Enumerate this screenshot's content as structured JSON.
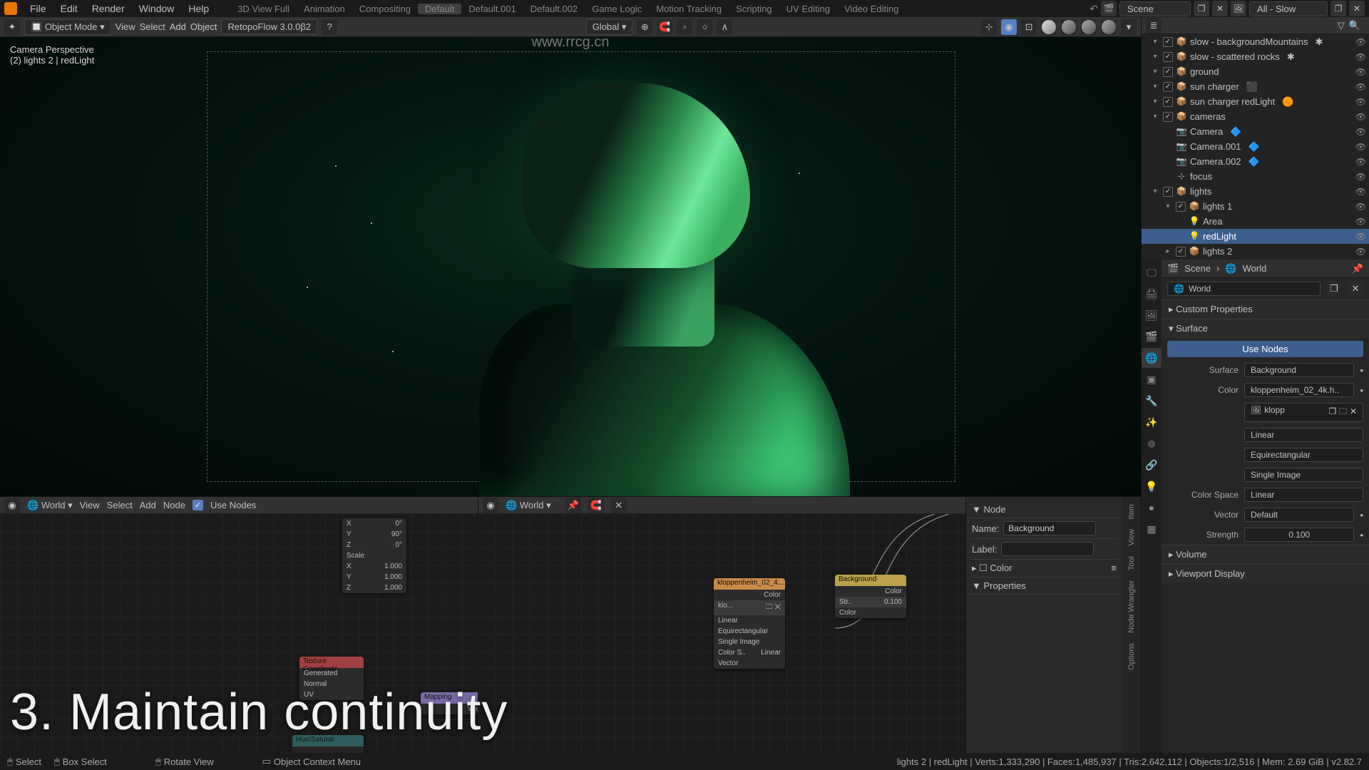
{
  "top_menu": {
    "items": [
      "File",
      "Edit",
      "Render",
      "Window",
      "Help"
    ],
    "workspaces": [
      "3D View Full",
      "Animation",
      "Compositing",
      "Default",
      "Default.001",
      "Default.002",
      "Game Logic",
      "Motion Tracking",
      "Scripting",
      "UV Editing",
      "Video Editing"
    ],
    "active_workspace": "Default",
    "scene_label": "Scene",
    "layer_label": "All - Slow"
  },
  "view3d_header": {
    "mode": "Object Mode",
    "menus": [
      "View",
      "Select",
      "Add",
      "Object"
    ],
    "addon": "RetopoFlow 3.0.0β2",
    "orientation": "Global"
  },
  "viewport": {
    "line1": "Camera Perspective",
    "line2": "(2) lights 2 | redLight"
  },
  "outliner": [
    {
      "depth": 0,
      "check": true,
      "icon": "📦",
      "label": "slow - backgroundMountains",
      "extra": "✱",
      "open": true
    },
    {
      "depth": 0,
      "check": true,
      "icon": "📦",
      "label": "slow - scattered rocks",
      "extra": "✱",
      "open": true
    },
    {
      "depth": 0,
      "check": true,
      "icon": "📦",
      "label": "ground",
      "open": true
    },
    {
      "depth": 0,
      "check": true,
      "icon": "📦",
      "label": "sun charger",
      "extra": "⬛",
      "open": true
    },
    {
      "depth": 0,
      "check": true,
      "icon": "📦",
      "label": "sun charger redLight",
      "extra": "🟠",
      "open": true
    },
    {
      "depth": 0,
      "check": true,
      "icon": "📦",
      "label": "cameras",
      "open": true
    },
    {
      "depth": 1,
      "icon": "📷",
      "label": "Camera",
      "extra": "🔷"
    },
    {
      "depth": 1,
      "icon": "📷",
      "label": "Camera.001",
      "extra": "🔷"
    },
    {
      "depth": 1,
      "icon": "📷",
      "label": "Camera.002",
      "extra": "🔷"
    },
    {
      "depth": 1,
      "icon": "⊹",
      "label": "focus"
    },
    {
      "depth": 0,
      "check": true,
      "icon": "📦",
      "label": "lights",
      "open": true
    },
    {
      "depth": 1,
      "check": true,
      "icon": "📦",
      "label": "lights 1",
      "open": true
    },
    {
      "depth": 2,
      "icon": "💡",
      "label": "Area",
      "color": "#e0a040"
    },
    {
      "depth": 2,
      "icon": "💡",
      "label": "redLight",
      "selected": true,
      "color": "#e0a040"
    },
    {
      "depth": 1,
      "check": true,
      "icon": "📦",
      "label": "lights 2",
      "open": false
    }
  ],
  "prop_crumb": {
    "scene": "Scene",
    "world": "World"
  },
  "prop_world": {
    "world_name": "World",
    "sections": {
      "custom": "Custom Properties",
      "surface": "Surface",
      "use_nodes_btn": "Use Nodes",
      "surface_label": "Surface",
      "surface_value": "Background",
      "color_label": "Color",
      "color_value": "kloppenheim_02_4k.h..",
      "image_name": "klopp",
      "interp": "Linear",
      "projection": "Equirectangular",
      "single": "Single Image",
      "colorspace_label": "Color Space",
      "colorspace_value": "Linear",
      "vector_label": "Vector",
      "vector_value": "Default",
      "strength_label": "Strength",
      "strength_value": "0.100",
      "volume": "Volume",
      "viewport": "Viewport Display"
    }
  },
  "node_editor": {
    "world": "World",
    "menus": [
      "View",
      "Select",
      "Add",
      "Node"
    ],
    "use_nodes_label": "Use Nodes",
    "sidebar": {
      "node_section": "Node",
      "name_label": "Name:",
      "name_value": "Background",
      "label_label": "Label:",
      "label_value": "",
      "color_label": "Color",
      "props_label": "Properties"
    },
    "tabs": [
      "Item",
      "View",
      "Node Wrangler",
      "Tool",
      "Options"
    ],
    "nodes": {
      "mapping": {
        "title": "Mapping",
        "rows": [
          [
            "X",
            "0°"
          ],
          [
            "Y",
            "90°"
          ],
          [
            "Z",
            "0°"
          ],
          [
            "Scale",
            ""
          ],
          [
            "X",
            "1.000"
          ],
          [
            "Y",
            "1.000"
          ],
          [
            "Z",
            "1.000"
          ]
        ]
      },
      "texcoord": {
        "title": "Texture Coordinate",
        "rows": [
          [
            "Generated",
            ""
          ],
          [
            "Normal",
            ""
          ],
          [
            "UV",
            ""
          ]
        ]
      },
      "envtex": {
        "title": "kloppenheim_02_4...",
        "rows": [
          [
            "",
            "Color"
          ],
          [
            "klo...",
            "🗀 ✕"
          ],
          [
            "Linear",
            ""
          ],
          [
            "Equirectangular",
            ""
          ],
          [
            "Single Image",
            ""
          ],
          [
            "",
            "Linear"
          ],
          [
            "Color S..",
            "Linear"
          ],
          [
            "Vector",
            ""
          ]
        ]
      },
      "background": {
        "title": "Background",
        "rows": [
          [
            "",
            "Color"
          ],
          [
            "Str..",
            "0.100"
          ],
          [
            "Color",
            ""
          ]
        ]
      },
      "mapping2": {
        "title": "Mapping",
        "rows": [
          [
            "",
            "Vector"
          ]
        ]
      },
      "hue": {
        "title": "Hue/Saturat",
        "rows": [
          [
            "",
            ""
          ]
        ]
      }
    }
  },
  "status_bar": {
    "left": [
      {
        "icon": "🖱",
        "text": "Select"
      },
      {
        "icon": "🖱",
        "text": "Box Select"
      },
      {
        "icon": "🖱",
        "text": "Rotate View"
      },
      {
        "icon": "▭",
        "text": "Object Context Menu"
      }
    ],
    "right": "lights 2 | redLight | Verts:1,333,290 | Faces:1,485,937 | Tris:2,642,112 | Objects:1/2,516 | Mem: 2.69 GiB | v2.82.7"
  },
  "caption": "3. Maintain continuity",
  "watermark_url": "www.rrcg.cn"
}
